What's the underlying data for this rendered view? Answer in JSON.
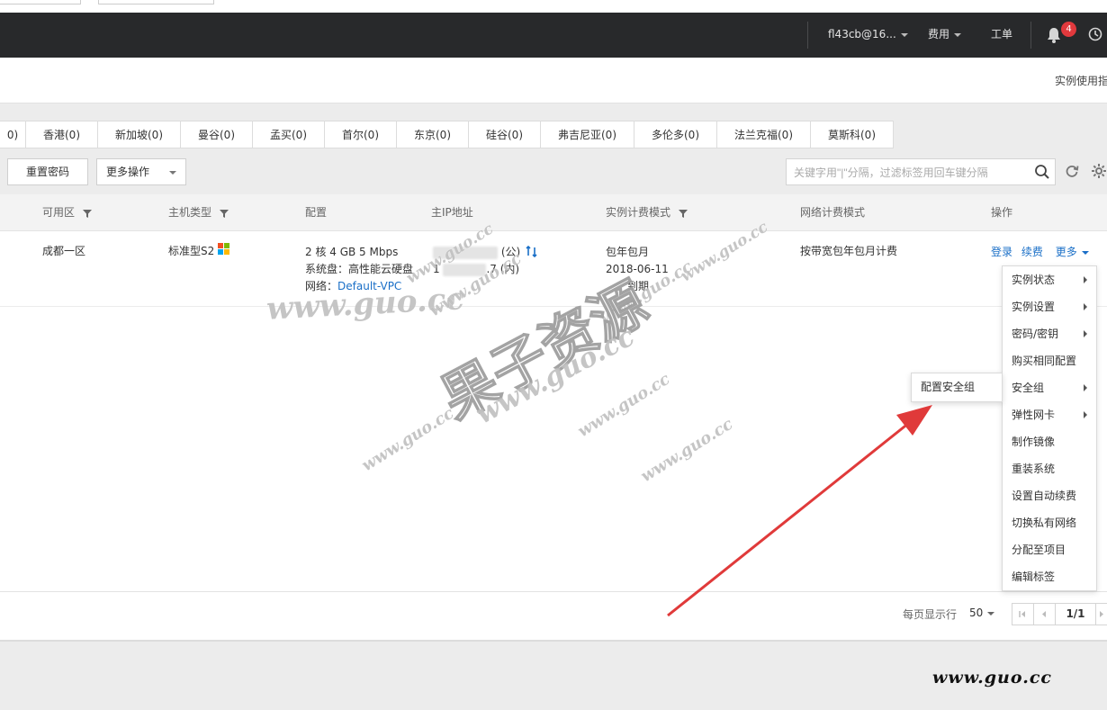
{
  "header": {
    "account": "fl43cb@16...",
    "billing": "费用",
    "ticket": "工单",
    "notifications_count": "4"
  },
  "subhead": {
    "guide_link": "实例使用指"
  },
  "region_tabs": [
    "0)",
    "香港(0)",
    "新加坡(0)",
    "曼谷(0)",
    "孟买(0)",
    "首尔(0)",
    "东京(0)",
    "硅谷(0)",
    "弗吉尼亚(0)",
    "多伦多(0)",
    "法兰克福(0)",
    "莫斯科(0)"
  ],
  "toolbar": {
    "reset_password": "重置密码",
    "more_actions": "更多操作",
    "search_placeholder": "关键字用\"|\"分隔，过滤标签用回车键分隔"
  },
  "table": {
    "headers": {
      "zone": "可用区",
      "host_type": "主机类型",
      "config": "配置",
      "ip": "主IP地址",
      "billing_mode": "实例计费模式",
      "net_billing": "网络计费模式",
      "actions": "操作"
    },
    "row": {
      "zone": "成都一区",
      "host_type": "标准型S2",
      "config_line1": "2 核 4 GB 5 Mbps",
      "config_line2": "系统盘：高性能云硬盘",
      "config_line3_label": "网络：",
      "config_line3_value": "Default-VPC",
      "ip_public_suffix": "(公)",
      "ip_private_prefix": "1",
      "ip_private_suffix": ".7 (内)",
      "billing_line1": "包年包月",
      "billing_line2": "2018-06-11",
      "billing_line3": "到期",
      "net_billing": "按带宽包年包月计费",
      "action_login": "登录",
      "action_renew": "续费",
      "action_more": "更多"
    }
  },
  "more_menu": [
    {
      "label": "实例状态",
      "submenu": true
    },
    {
      "label": "实例设置",
      "submenu": true
    },
    {
      "label": "密码/密钥",
      "submenu": true
    },
    {
      "label": "购买相同配置",
      "submenu": false
    },
    {
      "label": "安全组",
      "submenu": true
    },
    {
      "label": "弹性网卡",
      "submenu": true
    },
    {
      "label": "制作镜像",
      "submenu": false
    },
    {
      "label": "重装系统",
      "submenu": false
    },
    {
      "label": "设置自动续费",
      "submenu": false
    },
    {
      "label": "切换私有网络",
      "submenu": false
    },
    {
      "label": "分配至项目",
      "submenu": false
    },
    {
      "label": "编辑标签",
      "submenu": false
    }
  ],
  "security_submenu": {
    "item": "配置安全组"
  },
  "pagination": {
    "per_page_label": "每页显示行",
    "per_page_value": "50",
    "page": "1/1"
  },
  "watermark": {
    "big_text": "果子资源",
    "url_text": "www.guo.cc",
    "corner_text": "www.guo.cc"
  },
  "colors": {
    "header_bg": "#28292b",
    "link": "#1a6fc7",
    "badge": "#e1393d",
    "arrow": "#e03a3a"
  }
}
